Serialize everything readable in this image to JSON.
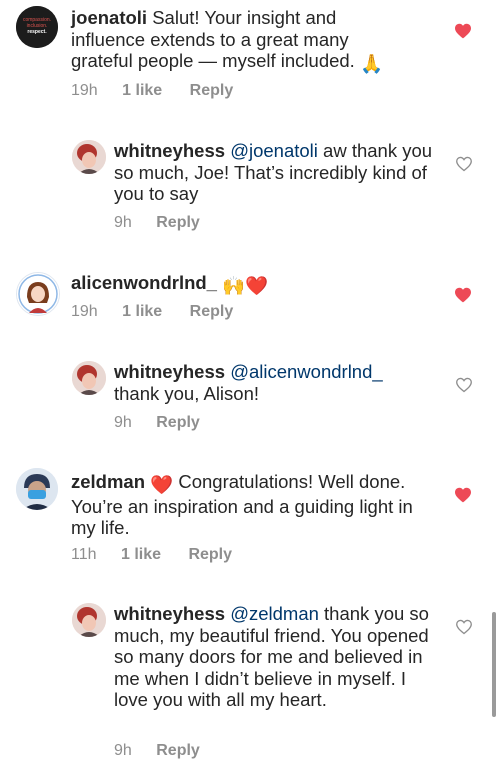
{
  "comments": [
    {
      "username": "joenatoli",
      "text": "Salut! Your insight and influence extends to a great many grateful people — myself included.",
      "emoji": "🙏",
      "time": "19h",
      "likes": "1 like",
      "reply": "Reply",
      "liked": true,
      "avatar_text": [
        "compassion.",
        "inclusion.",
        "respect."
      ]
    },
    {
      "username": "whitneyhess",
      "mention": "@joenatoli",
      "text": " aw thank you so much, Joe! That’s incredibly kind of you to say",
      "time": "9h",
      "reply": "Reply",
      "liked": false
    },
    {
      "username": "alicenwondrlnd_",
      "emoji": "🙌❤️",
      "time": "19h",
      "likes": "1 like",
      "reply": "Reply",
      "liked": true
    },
    {
      "username": "whitneyhess",
      "mention": "@alicenwondrlnd_",
      "text": "thank you, Alison!",
      "time": "9h",
      "reply": "Reply",
      "liked": false
    },
    {
      "username": "zeldman",
      "emoji": "❤️",
      "text": " Congratulations! Well done. You’re an inspiration and a guiding light in my life.",
      "time": "11h",
      "likes": "1 like",
      "reply": "Reply",
      "liked": true
    },
    {
      "username": "whitneyhess",
      "mention": "@zeldman",
      "text": " thank you so much, my beautiful friend. You opened so many doors for me and believed in me when I didn’t believe in myself. I love you with all my heart.",
      "time": "9h",
      "reply": "Reply",
      "liked": false
    }
  ],
  "colors": {
    "text": "#262626",
    "meta": "#8e8e8e",
    "mention": "#00376b",
    "heart_liked": "#ed4956",
    "heart_outline": "#8e8e8e"
  }
}
